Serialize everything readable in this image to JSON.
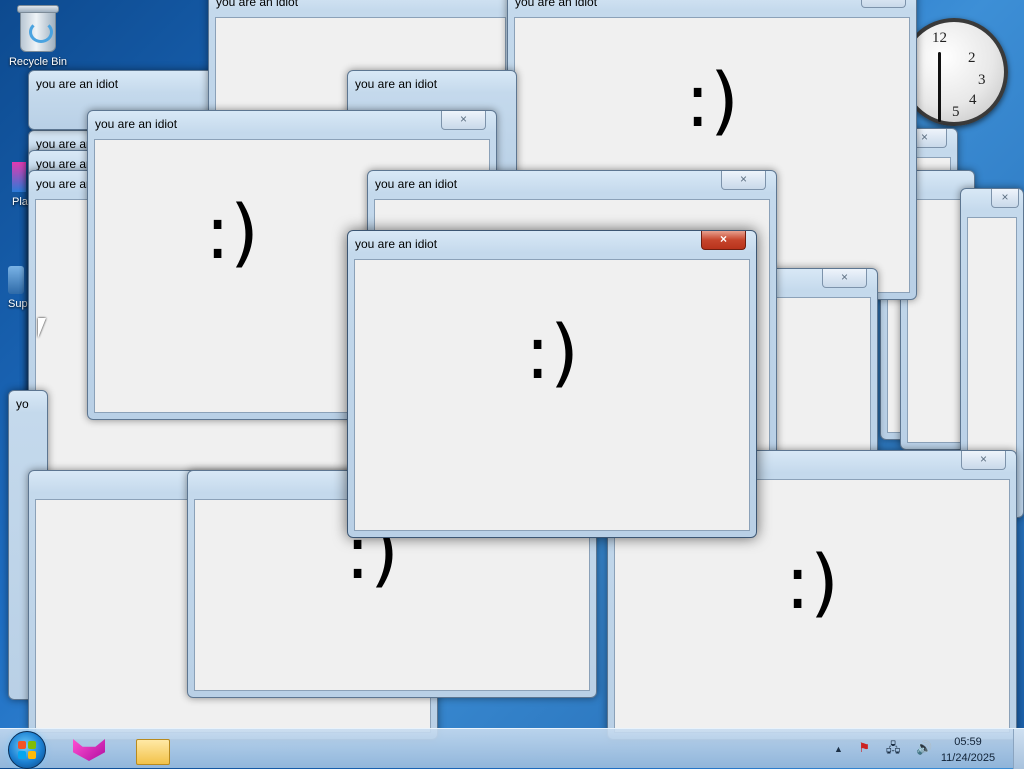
{
  "desktop": {
    "icons": [
      {
        "label": "Recycle Bin",
        "icon": "recycle-bin-icon"
      },
      {
        "label": "Pla",
        "icon": "media-icon"
      },
      {
        "label": "Sup",
        "icon": "support-icon"
      }
    ]
  },
  "gadget_clock": {
    "numbers": [
      "12",
      "2",
      "3",
      "4",
      "5"
    ]
  },
  "popup_windows": {
    "title": "you are an idiot",
    "message": ":)",
    "close_glyph": "×",
    "partial_title": "yo"
  },
  "taskbar": {
    "pinned": [
      {
        "name": "cat-app",
        "icon": "pink-cat-icon"
      },
      {
        "name": "file-explorer",
        "icon": "folder-icon"
      }
    ],
    "tray": {
      "show_hidden": "▲",
      "flag": "⚑",
      "network": "🖧",
      "volume": "🔊",
      "time": "05:59",
      "date": "11/24/2025"
    }
  },
  "colors": {
    "close_active": "#c6452c",
    "desktop_blue": "#1f6fc4"
  }
}
